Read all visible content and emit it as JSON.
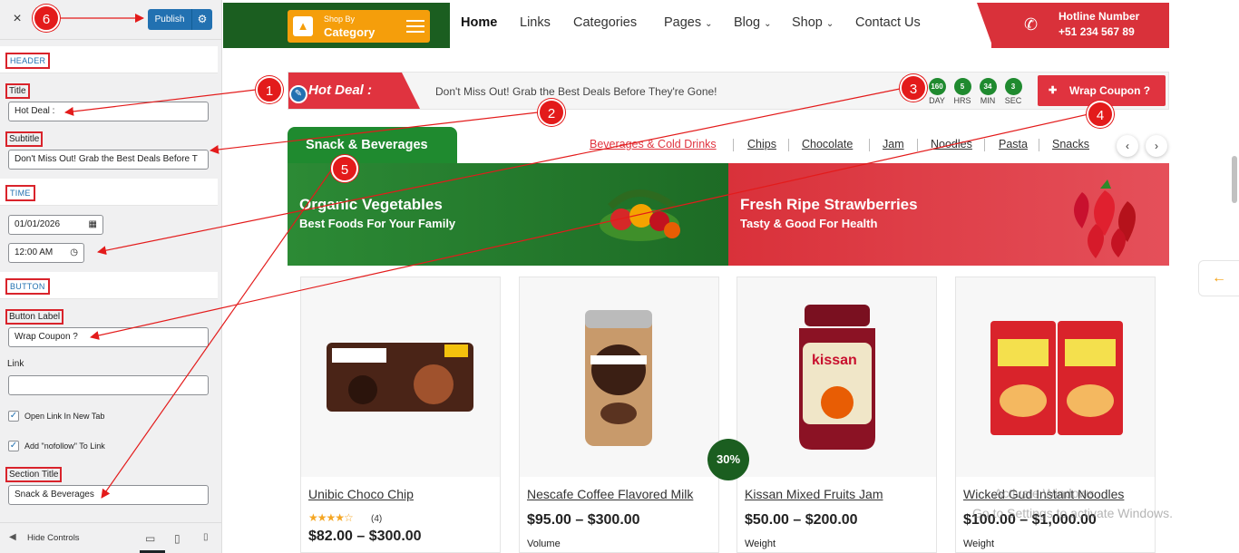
{
  "customizer": {
    "close_icon": "×",
    "publish_label": "Publish",
    "gear_icon": "⚙",
    "sections": {
      "header": "HEADER",
      "time": "TIME",
      "button": "BUTTON"
    },
    "fields": {
      "title_label": "Title",
      "title_value": "Hot Deal :",
      "subtitle_label": "Subtitle",
      "subtitle_value": "Don't Miss Out! Grab the Best Deals Before T",
      "date_value": "01/01/2026",
      "time_value": "12:00 AM",
      "button_label_label": "Button Label",
      "button_label_value": "Wrap Coupon ?",
      "link_label": "Link",
      "link_value": "",
      "open_new_tab_label": "Open Link In New Tab",
      "nofollow_label": "Add \"nofollow\" To Link",
      "section_title_label": "Section Title",
      "section_title_value": "Snack & Beverages"
    },
    "footer": {
      "hide_controls": "Hide Controls"
    }
  },
  "site": {
    "shop_by_line1": "Shop By",
    "shop_by_line2": "Category",
    "nav": [
      "Home",
      "Links",
      "Categories",
      "Pages",
      "Blog",
      "Shop",
      "Contact Us"
    ],
    "hotline_title": "Hotline Number",
    "hotline_number": "+51 234 567 89",
    "hot_deal": {
      "title": "Hot Deal :",
      "subtitle": "Don't Miss Out! Grab the Best Deals Before They're Gone!",
      "countdown": [
        {
          "value": "160",
          "unit": "DAY"
        },
        {
          "value": "5",
          "unit": "HRS"
        },
        {
          "value": "34",
          "unit": "MIN"
        },
        {
          "value": "3",
          "unit": "SEC"
        }
      ],
      "button": "Wrap Coupon ?"
    },
    "section_title": "Snack & Beverages",
    "categories": [
      "Beverages & Cold Drinks",
      "Chips",
      "Chocolate",
      "Jam",
      "Noodles",
      "Pasta",
      "Snacks"
    ],
    "banners": [
      {
        "title": "Organic Vegetables",
        "subtitle": "Best Foods For Your Family"
      },
      {
        "title": "Fresh Ripe Strawberries",
        "subtitle": "Tasty & Good For Health"
      }
    ],
    "products": [
      {
        "name": "Unibic Choco Chip",
        "rating_count": "(4)",
        "price": "$82.00 – $300.00",
        "attr": ""
      },
      {
        "name": "Nescafe Coffee Flavored Milk",
        "price": "$95.00 – $300.00",
        "attr": "Volume"
      },
      {
        "name": "Kissan Mixed Fruits Jam",
        "price": "$50.00 – $200.00",
        "attr": "Weight"
      },
      {
        "name": "Wicked Gud Instant Noodles",
        "price": "$100.00 – $1,000.00",
        "attr": "Weight"
      }
    ],
    "sale_badge": "30%",
    "watermark_line1": "Activate Windows",
    "watermark_line2": "Go to Settings to activate Windows."
  },
  "annotations": [
    "1",
    "2",
    "3",
    "4",
    "5",
    "6"
  ],
  "colors": {
    "accent_green": "#1f8a2f",
    "accent_red": "#e0333f",
    "accent_orange": "#f59e0b",
    "wp_blue": "#2271b1",
    "annotation_red": "#e31b1b"
  }
}
